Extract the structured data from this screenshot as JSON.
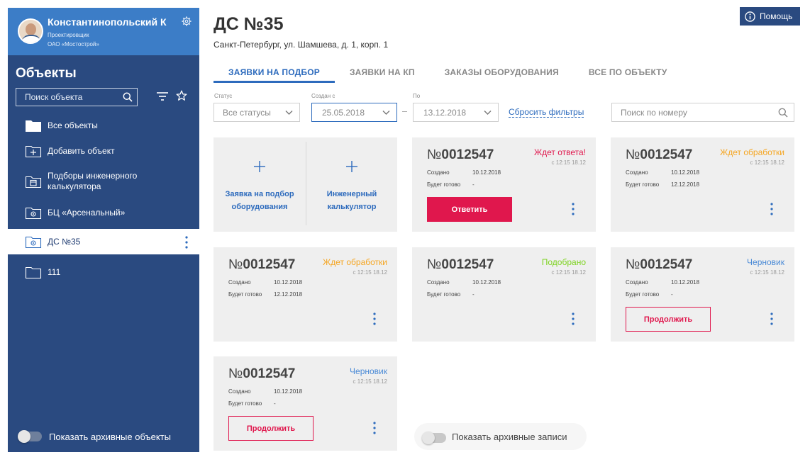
{
  "user": {
    "name": "Константинопольский К",
    "role": "Проектировщик",
    "org": "ОАО «Мостострой»"
  },
  "sidebar": {
    "title": "Объекты",
    "search_placeholder": "Поиск объекта",
    "items": [
      {
        "label": "Все объекты",
        "icon": "folder-icon"
      },
      {
        "label": "Добавить объект",
        "icon": "folder-add-icon"
      },
      {
        "label": "Подборы инженерного калькулятора",
        "icon": "folder-calculator-icon"
      },
      {
        "label": "БЦ «Арсенальный»",
        "icon": "folder-gear-icon"
      },
      {
        "label": "ДС №35",
        "icon": "folder-gear-icon",
        "active": true
      },
      {
        "label": "111",
        "icon": "folder-icon"
      }
    ],
    "archive_label": "Показать архивные объекты"
  },
  "help_label": "Помощь",
  "page": {
    "title": "ДС №35",
    "address": "Санкт-Петербург, ул. Шамшева, д. 1, корп. 1"
  },
  "tabs": [
    {
      "label": "ЗАЯВКИ НА ПОДБОР",
      "active": true
    },
    {
      "label": "ЗАЯВКИ НА КП"
    },
    {
      "label": "ЗАКАЗЫ ОБОРУДОВАНИЯ"
    },
    {
      "label": "ВСЕ ПО ОБЪЕКТУ"
    }
  ],
  "filters": {
    "status_label": "Статус",
    "status_value": "Все статусы",
    "created_label": "Создан с",
    "created_from": "25.05.2018",
    "to_label": "По",
    "created_to": "13.12.2018",
    "reset": "Сбросить фильтры",
    "number_placeholder": "Поиск по номеру"
  },
  "new_card": {
    "request": "Заявка на подбор оборудования",
    "calculator": "Инженерный калькулятор"
  },
  "card_labels": {
    "num_prefix": "№",
    "created": "Создано",
    "ready": "Будет готово",
    "reply": "Ответить",
    "continue": "Продолжить"
  },
  "colors": {
    "accent_blue": "#2d6bbd",
    "sidebar": "#2a4a80",
    "red": "#e0174d",
    "orange": "#f5a623",
    "green": "#7ed321"
  },
  "cards": [
    {
      "number": "0012547",
      "status": "Ждет ответа!",
      "status_color": "#e0174d",
      "time": "с 12:15 18.12",
      "created": "10.12.2018",
      "ready": "-"
    },
    {
      "number": "0012547",
      "status": "Ждет обработки",
      "status_color": "#f5a623",
      "time": "с 12:15 18.12",
      "created": "10.12.2018",
      "ready": "12.12.2018"
    },
    {
      "number": "0012547",
      "status": "Ждет обработки",
      "status_color": "#f5a623",
      "time": "с 12:15 18.12",
      "created": "10.12.2018",
      "ready": "12.12.2018"
    },
    {
      "number": "0012547",
      "status": "Подобрано",
      "status_color": "#7ed321",
      "time": "с 12:15 18.12",
      "created": "10.12.2018",
      "ready": "-"
    },
    {
      "number": "0012547",
      "status": "Черновик",
      "status_color": "#4a8ad6",
      "time": "с 12:15 18.12",
      "created": "10.12.2018",
      "ready": "-"
    },
    {
      "number": "0012547",
      "status": "Черновик",
      "status_color": "#4a8ad6",
      "time": "с 12:15 18.12",
      "created": "10.12.2018",
      "ready": "-"
    }
  ],
  "main_archive_label": "Показать архивные записи"
}
